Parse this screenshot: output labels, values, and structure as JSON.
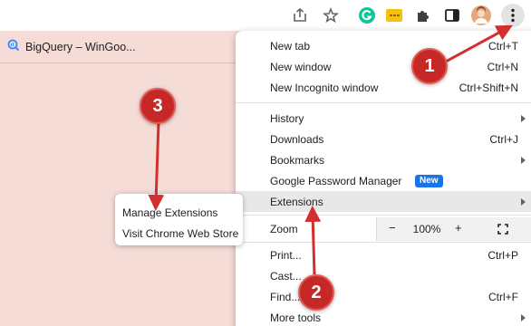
{
  "colors": {
    "page_bg": "#f5dcd7",
    "accent": "#1a73e8",
    "annotation": "#d32f2f"
  },
  "toolbar": {
    "icons": [
      "share-icon",
      "star-icon",
      "grammarly-icon",
      "extension-yellow-icon",
      "puzzle-icon",
      "side-panel-icon",
      "avatar",
      "kebab-menu-icon"
    ]
  },
  "bookmarks": {
    "items": [
      {
        "label": "BigQuery – WinGoo...",
        "icon": "bigquery-icon"
      }
    ]
  },
  "menu": {
    "items": {
      "new_tab": {
        "label": "New tab",
        "shortcut": "Ctrl+T"
      },
      "new_window": {
        "label": "New window",
        "shortcut": "Ctrl+N"
      },
      "incognito": {
        "label": "New Incognito window",
        "shortcut": "Ctrl+Shift+N"
      },
      "history": {
        "label": "History"
      },
      "downloads": {
        "label": "Downloads",
        "shortcut": "Ctrl+J"
      },
      "bookmarks": {
        "label": "Bookmarks"
      },
      "password": {
        "label": "Google Password Manager",
        "badge": "New"
      },
      "extensions": {
        "label": "Extensions"
      },
      "zoom": {
        "label": "Zoom",
        "minus": "−",
        "value": "100%",
        "plus": "+"
      },
      "print": {
        "label": "Print...",
        "shortcut": "Ctrl+P"
      },
      "cast": {
        "label": "Cast..."
      },
      "find": {
        "label": "Find...",
        "shortcut": "Ctrl+F"
      },
      "more_tools": {
        "label": "More tools"
      }
    }
  },
  "submenu": {
    "manage": "Manage Extensions",
    "store": "Visit Chrome Web Store"
  },
  "annotations": {
    "one": "1",
    "two": "2",
    "three": "3"
  }
}
